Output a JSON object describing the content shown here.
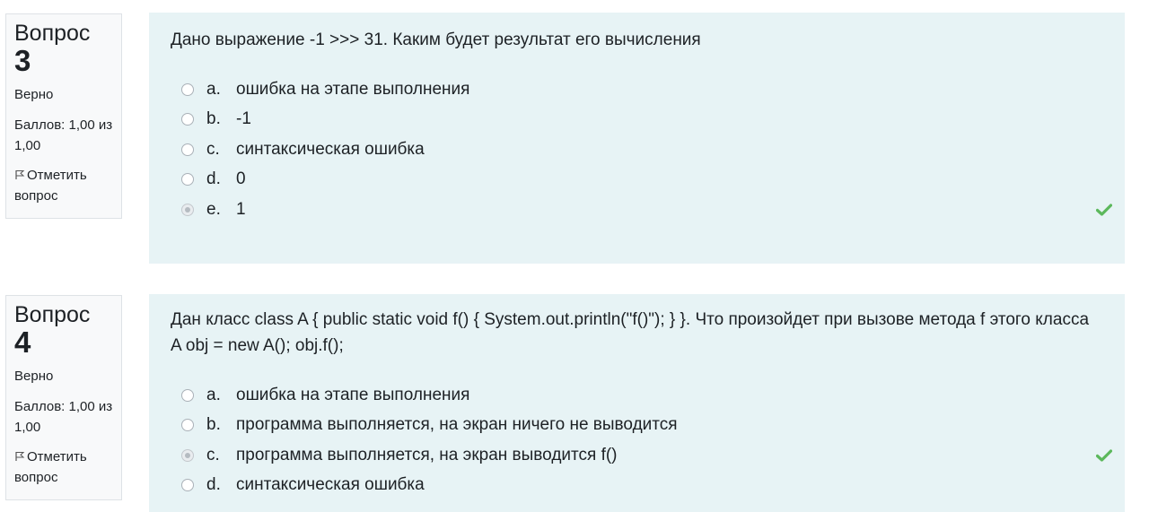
{
  "questions": [
    {
      "title": "Вопрос",
      "number": "3",
      "state": "Верно",
      "grade": "Баллов: 1,00 из 1,00",
      "flag_label": "Отметить вопрос",
      "text": "Дано выражение -1 >>> 31. Каким будет результат его вычисления",
      "answers": [
        {
          "letter": "a.",
          "text": "ошибка на этапе выполнения",
          "selected": false
        },
        {
          "letter": "b.",
          "text": "-1",
          "selected": false
        },
        {
          "letter": "c.",
          "text": "синтаксическая ошибка",
          "selected": false
        },
        {
          "letter": "d.",
          "text": "0",
          "selected": false
        },
        {
          "letter": "e.",
          "text": "1",
          "selected": true,
          "correct_icon": "check-icon"
        }
      ]
    },
    {
      "title": "Вопрос",
      "number": "4",
      "state": "Верно",
      "grade": "Баллов: 1,00 из 1,00",
      "flag_label": "Отметить вопрос",
      "text": "Дан класс class A { public static void f() { System.out.println(\"f()\"); } }. Что произойдет при вызове метода f этого класса A obj = new A(); obj.f();",
      "answers": [
        {
          "letter": "a.",
          "text": "ошибка на этапе выполнения",
          "selected": false
        },
        {
          "letter": "b.",
          "text": "программа выполняется, на экран ничего не выводится",
          "selected": false
        },
        {
          "letter": "c.",
          "text": "программа выполняется, на экран выводится f()",
          "selected": true,
          "correct_icon": "check-icon"
        },
        {
          "letter": "d.",
          "text": "синтаксическая ошибка",
          "selected": false
        }
      ]
    }
  ],
  "colors": {
    "content_bg": "#e7f3f5",
    "info_bg": "#f8f9fa",
    "check": "#5cb85c"
  },
  "icons": {
    "flag": "flag-icon",
    "correct": "check-icon"
  }
}
